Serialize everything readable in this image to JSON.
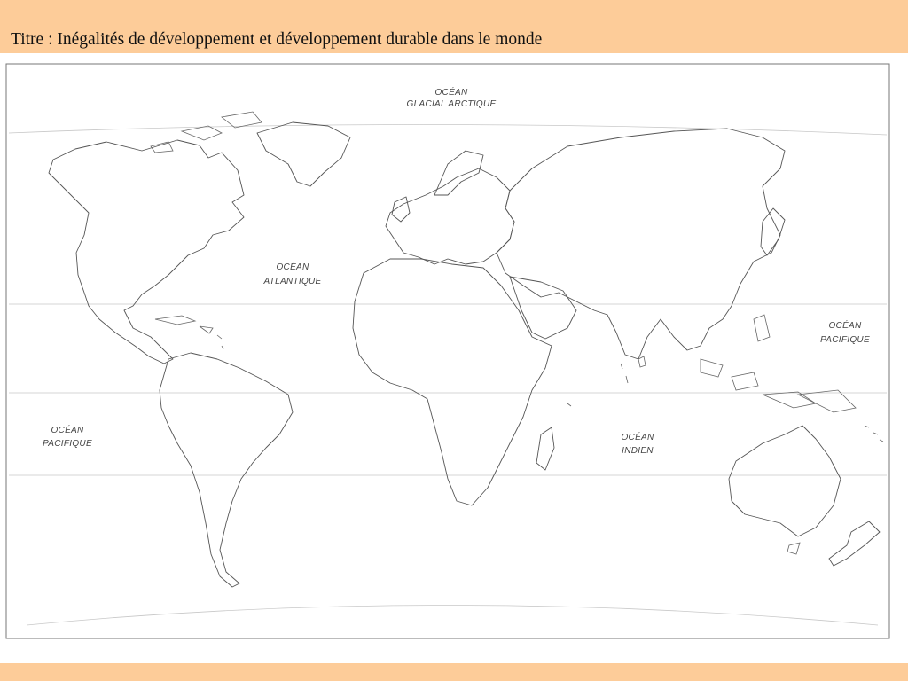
{
  "title": "Titre : Inégalités de développement et développement durable dans le monde",
  "colors": {
    "band": "#fdcc99",
    "outline": "#555555"
  },
  "map": {
    "oceans": {
      "arctic": {
        "line1": "OCÉAN",
        "line2": "GLACIAL ARCTIQUE"
      },
      "atlantic": {
        "line1": "OCÉAN",
        "line2": "ATLANTIQUE"
      },
      "pacific_west": {
        "line1": "OCÉAN",
        "line2": "PACIFIQUE"
      },
      "pacific_east": {
        "line1": "OCÉAN",
        "line2": "PACIFIQUE"
      },
      "indian": {
        "line1": "OCÉAN",
        "line2": "INDIEN"
      }
    }
  }
}
